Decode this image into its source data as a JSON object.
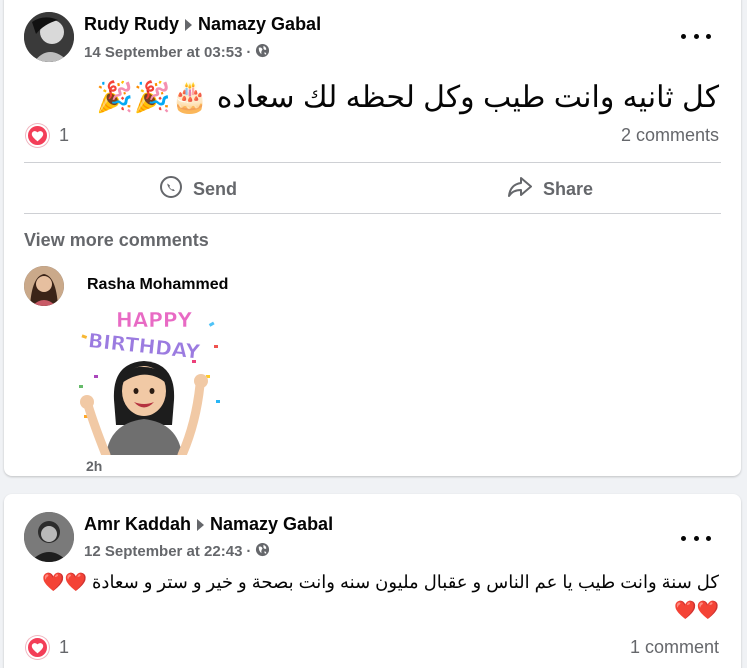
{
  "post1": {
    "author": "Rudy Rudy",
    "target": "Namazy Gabal",
    "timestamp": "14 September at 03:53",
    "privacy_icon": "globe-icon",
    "text": "كل ثانيه وانت طيب وكل لحظه لك سعاده 🎂🎉🎉",
    "reaction_count": "1",
    "comments_count": "2 comments",
    "send_label": "Send",
    "share_label": "Share",
    "view_more": "View more comments",
    "comment": {
      "author": "Rasha Mohammed",
      "sticker_text_line1": "HAPPY",
      "sticker_text_line2": "BIRTHDAY",
      "time": "2h"
    }
  },
  "post2": {
    "author": "Amr Kaddah",
    "target": "Namazy Gabal",
    "timestamp": "12 September at 22:43",
    "privacy_icon": "globe-icon",
    "text_line1": "كل سنة وانت طيب يا عم الناس و عقبال مليون سنه وانت بصحة و خير و ستر و سعادة ❤️❤️",
    "text_line2": "❤️❤️",
    "reaction_count": "1",
    "comments_count": "1 comment"
  },
  "colors": {
    "background": "#f0f2f5",
    "card": "#ffffff",
    "secondary_text": "#65676b",
    "heart_red": "#f33e58"
  }
}
